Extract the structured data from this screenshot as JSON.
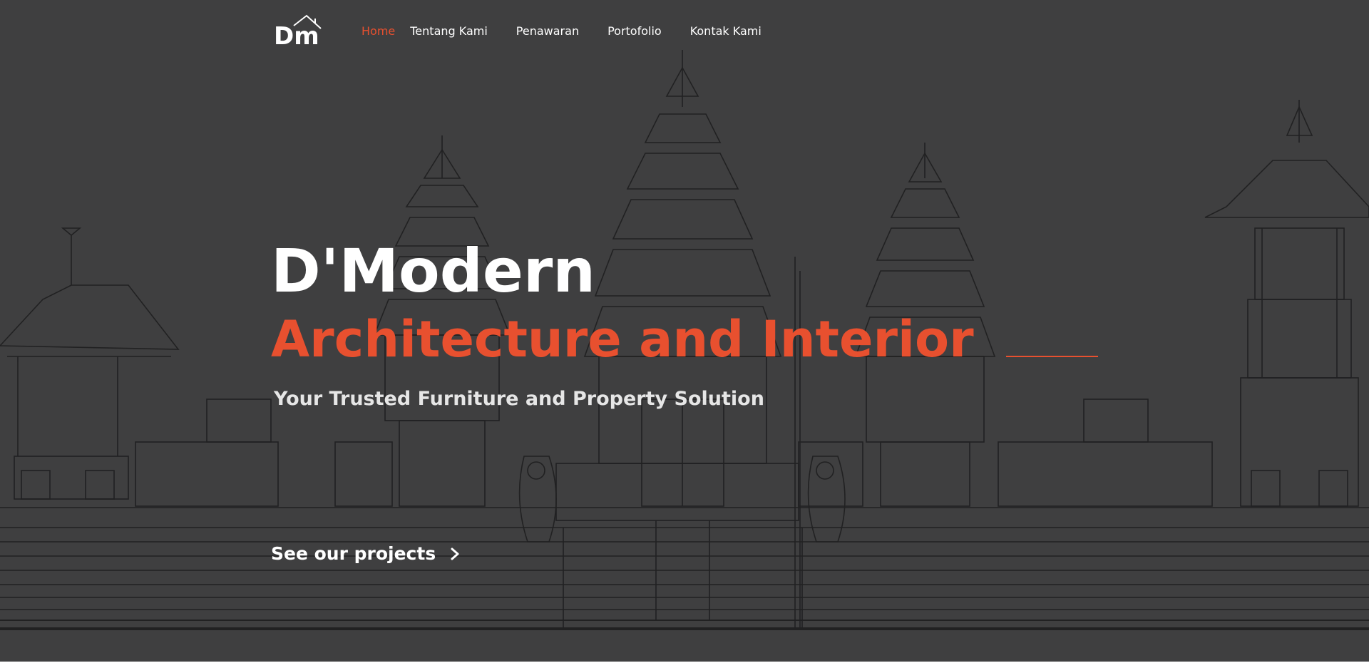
{
  "brand": {
    "logo_text": "Dm",
    "accent_color": "#e8502f",
    "background_color": "#3f3f40"
  },
  "nav": {
    "items": [
      {
        "label": "Home",
        "active": true
      },
      {
        "label": "Tentang Kami",
        "active": false
      },
      {
        "label": "Penawaran",
        "active": false
      },
      {
        "label": "Portofolio",
        "active": false
      },
      {
        "label": "Kontak Kami",
        "active": false
      }
    ]
  },
  "hero": {
    "title_line_1": "D'Modern",
    "title_line_2": "Architecture and Interior",
    "subtitle": "Your Trusted Furniture and Property Solution",
    "cta_label": "See our projects",
    "cta_icon": "chevron-right-icon",
    "background_image": "temple-sketch-illustration"
  }
}
